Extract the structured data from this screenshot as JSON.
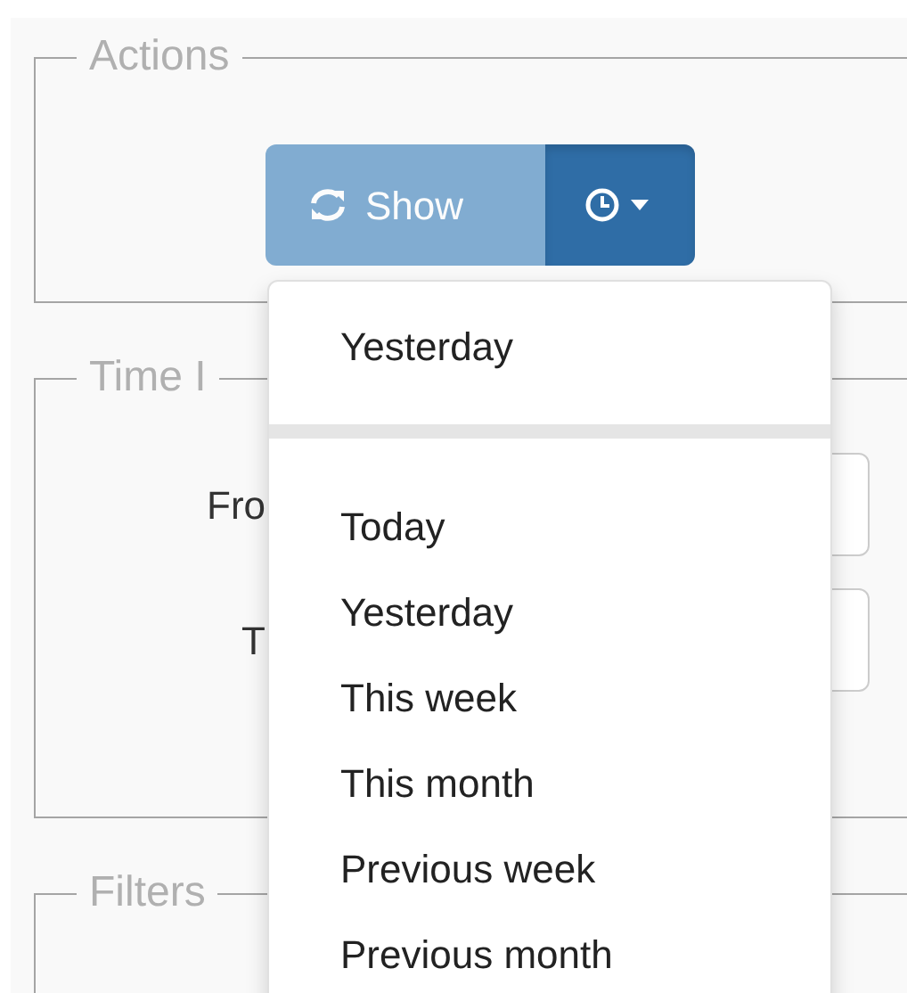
{
  "actions": {
    "legend": "Actions",
    "show_button": {
      "label": "Show",
      "disabled": true
    },
    "menu_toggle": {
      "expanded": true
    }
  },
  "dropdown": {
    "header_item": "Yesterday",
    "items": [
      {
        "label": "Today"
      },
      {
        "label": "Yesterday"
      },
      {
        "label": "This week"
      },
      {
        "label": "This month"
      },
      {
        "label": "Previous week"
      },
      {
        "label": "Previous month"
      }
    ]
  },
  "time_interval": {
    "legend": "Time I",
    "from_label": "Fro",
    "to_label": "T"
  },
  "filters": {
    "legend": "Filters"
  }
}
